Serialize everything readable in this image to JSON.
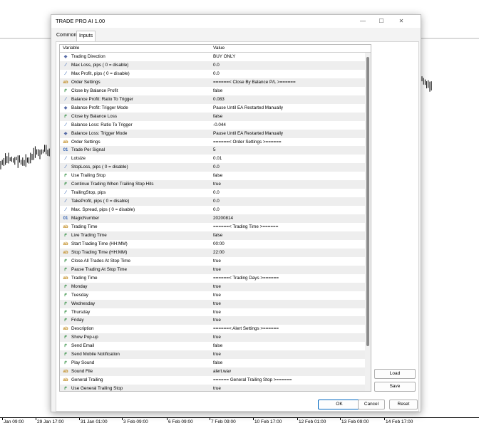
{
  "window": {
    "title": "TRADE PRO AI 1.00",
    "minimize_glyph": "—",
    "maximize_glyph": "☐",
    "close_glyph": "✕"
  },
  "tabs": [
    {
      "label": "Common"
    },
    {
      "label": "Inputs",
      "active": true
    }
  ],
  "columns": {
    "variable": "Variable",
    "value": "Value"
  },
  "type_glyphs": {
    "dir": "◆",
    "dbl": "⁄",
    "str": "ab",
    "bool": "↱",
    "int": "01"
  },
  "rows": [
    {
      "type": "dir",
      "name": "Trading Direction",
      "value": "BUY ONLY"
    },
    {
      "type": "dbl",
      "name": "Max Loss, pips ( 0 = disable)",
      "value": "0.0"
    },
    {
      "type": "dbl",
      "name": "Max Profit, pips ( 0 = disable)",
      "value": "0.0"
    },
    {
      "type": "str",
      "name": "Order Settings",
      "value": "======< Close By Balance P/L >======"
    },
    {
      "type": "bool",
      "name": "Close by Balance Profit",
      "value": "false"
    },
    {
      "type": "dbl",
      "name": "Balance Profit: Ratio To Trigger",
      "value": "0.083"
    },
    {
      "type": "dir",
      "name": "Balance Profit: Trigger Mode",
      "value": "Pause Until EA Restarted Manually"
    },
    {
      "type": "bool",
      "name": "Close by Balance Loss",
      "value": "false"
    },
    {
      "type": "dbl",
      "name": "Balance Loss: Ratio To Trigger",
      "value": "-0.044"
    },
    {
      "type": "dir",
      "name": "Balance Loss: Trigger Mode",
      "value": "Pause Until EA Restarted Manually"
    },
    {
      "type": "str",
      "name": "Order Settings",
      "value": "======< Order Settings >======"
    },
    {
      "type": "int",
      "name": "Trade Per Signal",
      "value": "5"
    },
    {
      "type": "dbl",
      "name": "Lotsize",
      "value": "0.01"
    },
    {
      "type": "dbl",
      "name": "StopLoss, pips ( 0 = disable)",
      "value": "0.0"
    },
    {
      "type": "bool",
      "name": "Use Trailing Stop",
      "value": "false"
    },
    {
      "type": "bool",
      "name": "Continue Trading When Trailing Stop Hits",
      "value": "true"
    },
    {
      "type": "dbl",
      "name": "TrailingStop, pips",
      "value": "0.0"
    },
    {
      "type": "dbl",
      "name": "TakeProfit, pips ( 0 = disable)",
      "value": "0.0"
    },
    {
      "type": "dbl",
      "name": "Max. Spread, pips ( 0 = disable)",
      "value": "0.0"
    },
    {
      "type": "int",
      "name": "MagicNumber",
      "value": "20200814"
    },
    {
      "type": "str",
      "name": "Trading Time",
      "value": "======< Trading Time >======"
    },
    {
      "type": "bool",
      "name": "Live Trading Time",
      "value": "false"
    },
    {
      "type": "str",
      "name": "Start Trading Time (HH:MM)",
      "value": "00:00"
    },
    {
      "type": "str",
      "name": "Stop Trading Time (HH:MM)",
      "value": "22:00"
    },
    {
      "type": "bool",
      "name": "Close All Trades At Stop Time",
      "value": "true"
    },
    {
      "type": "bool",
      "name": "Pause Trading At Stop Time",
      "value": "true"
    },
    {
      "type": "str",
      "name": "Trading Time",
      "value": "======< Trading Days >======"
    },
    {
      "type": "bool",
      "name": "Monday",
      "value": "true"
    },
    {
      "type": "bool",
      "name": "Tuesday",
      "value": "true"
    },
    {
      "type": "bool",
      "name": "Wednesday",
      "value": "true"
    },
    {
      "type": "bool",
      "name": "Thursday",
      "value": "true"
    },
    {
      "type": "bool",
      "name": "Friday",
      "value": "true"
    },
    {
      "type": "str",
      "name": "Description",
      "value": "======< Alert Settings >======"
    },
    {
      "type": "bool",
      "name": "Show Pop-up",
      "value": "true"
    },
    {
      "type": "bool",
      "name": "Send Email",
      "value": "false"
    },
    {
      "type": "bool",
      "name": "Send Mobile Notification",
      "value": "true"
    },
    {
      "type": "bool",
      "name": "Play Sound",
      "value": "false"
    },
    {
      "type": "str",
      "name": "Sound File",
      "value": "alert.wav"
    },
    {
      "type": "str",
      "name": "General Trailing",
      "value": "====== General Trailing Stop >======"
    },
    {
      "type": "bool",
      "name": "Use General Trailing Stop",
      "value": "true"
    }
  ],
  "side_buttons": {
    "load": "Load",
    "save": "Save"
  },
  "footer_buttons": {
    "ok": "OK",
    "cancel": "Cancel",
    "reset": "Reset"
  },
  "time_axis": [
    "Jan 09:00",
    "29 Jan 17:00",
    "31 Jan 01:00",
    "3 Feb 09:00",
    "6 Feb 09:00",
    "7 Feb 09:00",
    "10 Feb 17:00",
    "12 Feb 01:00",
    "13 Feb 09:00",
    "14 Feb 17:00"
  ],
  "colors": {
    "accent": "#0067c0",
    "row_alt": "#eeeeee",
    "candle": "#000000"
  }
}
